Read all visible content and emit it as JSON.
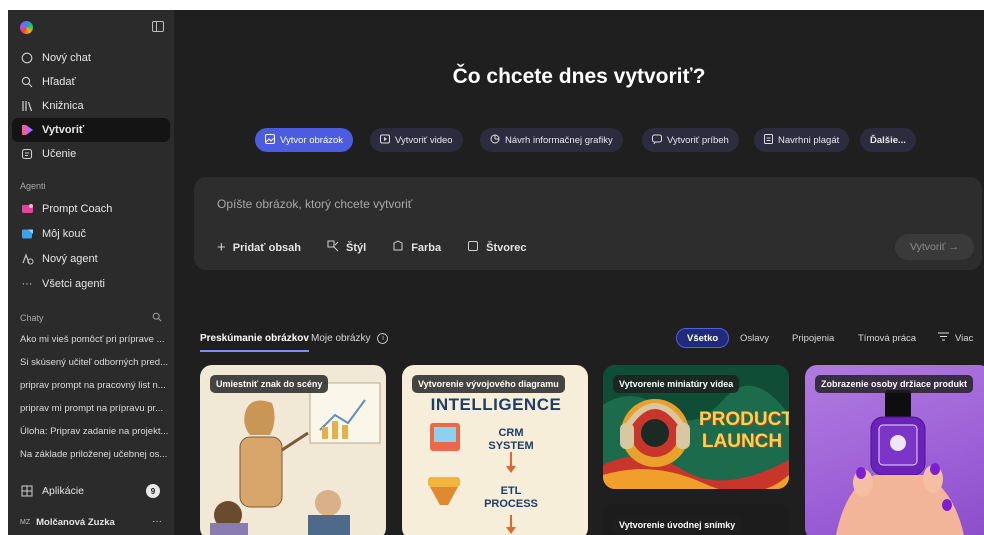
{
  "sidebar": {
    "nav": [
      {
        "label": "Nový chat",
        "icon": "chat-bubble-icon"
      },
      {
        "label": "Hľadať",
        "icon": "search-icon"
      },
      {
        "label": "Knižnica",
        "icon": "library-icon"
      },
      {
        "label": "Vytvoriť",
        "icon": "create-icon",
        "active": true
      },
      {
        "label": "Učenie",
        "icon": "learning-icon"
      }
    ],
    "agents_label": "Agenti",
    "agents": [
      {
        "label": "Prompt Coach",
        "icon": "prompt-coach-icon"
      },
      {
        "label": "Môj kouč",
        "icon": "coach-icon"
      },
      {
        "label": "Nový agent",
        "icon": "new-agent-icon"
      },
      {
        "label": "Všetci agenti",
        "icon": "more-icon"
      }
    ],
    "chats_label": "Chaty",
    "chats": [
      "Ako mi vieš pomôcť pri príprave ...",
      "Si skúsený učiteľ odborných pred...",
      "priprav prompt na pracovný list n...",
      "priprav mi prompt na prípravu pr...",
      "Úloha: Priprav zadanie na projekt...",
      "Na základe priloženej učebnej os..."
    ],
    "apps_label": "Aplikácie",
    "apps_count": "9",
    "user_initials": "MZ",
    "user_name": "Molčanová Zuzka"
  },
  "main": {
    "heading": "Čo chcete dnes vytvoriť?",
    "chips": [
      {
        "label": "Vytvor obrázok",
        "icon": "image-icon",
        "active": true
      },
      {
        "label": "Vytvoriť video",
        "icon": "video-icon"
      },
      {
        "label": "Návrh informačnej grafiky",
        "icon": "infographic-icon"
      },
      {
        "label": "Vytvoriť príbeh",
        "icon": "story-icon"
      },
      {
        "label": "Navrhni plagát",
        "icon": "poster-icon"
      },
      {
        "label": "Ďalšie...",
        "icon": ""
      }
    ],
    "composer": {
      "placeholder": "Opíšte obrázok, ktorý chcete vytvoriť",
      "tools": [
        {
          "label": "Pridať obsah",
          "icon": "plus-icon"
        },
        {
          "label": "Štýl",
          "icon": "style-icon"
        },
        {
          "label": "Farba",
          "icon": "color-icon"
        },
        {
          "label": "Štvorec",
          "icon": "square-icon"
        }
      ],
      "create_label": "Vytvoriť →"
    },
    "tabs": [
      {
        "label": "Preskúmanie obrázkov",
        "active": true
      },
      {
        "label": "Moje obrázky",
        "icon": "info-icon"
      }
    ],
    "filters": [
      {
        "label": "Všetko",
        "active": true
      },
      {
        "label": "Oslavy"
      },
      {
        "label": "Pripojenia"
      },
      {
        "label": "Tímová práca"
      },
      {
        "label": "Viac",
        "icon": "filter-icon"
      }
    ],
    "cards": [
      {
        "label": "Umiestniť znak do scény"
      },
      {
        "label": "Vytvorenie vývojového diagramu",
        "texts": [
          "INTELLIGENCE",
          "CRM",
          "SYSTEM",
          "ETL",
          "PROCESS"
        ]
      },
      {
        "label": "Vytvorenie miniatúry videa",
        "texts": [
          "PRODUCT",
          "LAUNCH"
        ]
      },
      {
        "label": "Vytvorenie úvodnej snímky"
      },
      {
        "label": "Zobrazenie osoby držiace produkt"
      }
    ]
  },
  "colors": {
    "sidebar_bg": "#2b2b2b",
    "main_bg": "#1f1f1f",
    "accent": "#4b5ce0",
    "chip_bg": "#2c2c3e"
  }
}
